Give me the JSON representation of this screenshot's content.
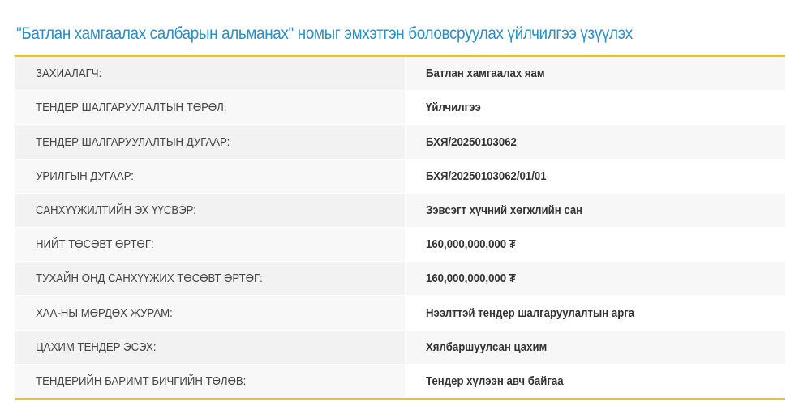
{
  "header": {
    "title": "\"Батлан хамгаалах салбарын альманах\" номыг эмхэтгэн боловсруулах үйлчилгээ үзүүлэх"
  },
  "colors": {
    "title": "#2a8fc2",
    "rule": "#f0c020"
  },
  "details": [
    {
      "label": "ЗАХИАЛАГЧ:",
      "value": "Батлан хамгаалах яам"
    },
    {
      "label": "ТЕНДЕР ШАЛГАРУУЛАЛТЫН ТӨРӨЛ:",
      "value": "Үйлчилгээ"
    },
    {
      "label": "ТЕНДЕР ШАЛГАРУУЛАЛТЫН ДУГААР:",
      "value": "БХЯ/20250103062"
    },
    {
      "label": "УРИЛГЫН ДУГААР:",
      "value": "БХЯ/20250103062/01/01"
    },
    {
      "label": "САНХҮҮЖИЛТИЙН ЭХ ҮҮСВЭР:",
      "value": "Зэвсэгт хүчний хөгжлийн сан"
    },
    {
      "label": "НИЙТ ТӨСӨВТ ӨРТӨГ:",
      "value": "160,000,000,000 ₮"
    },
    {
      "label": "ТУХАЙН ОНД САНХҮҮЖИХ ТӨСӨВТ ӨРТӨГ:",
      "value": "160,000,000,000 ₮"
    },
    {
      "label": "ХАА-НЫ МӨРДӨХ ЖУРАМ:",
      "value": "Нээлттэй тендер шалгаруулалтын арга"
    },
    {
      "label": "ЦАХИМ ТЕНДЕР ЭСЭХ:",
      "value": "Хялбаршуулсан цахим"
    },
    {
      "label": "ТЕНДЕРИЙН БАРИМТ БИЧГИЙН ТӨЛӨВ:",
      "value": "Тендер хүлээн авч байгаа"
    }
  ]
}
